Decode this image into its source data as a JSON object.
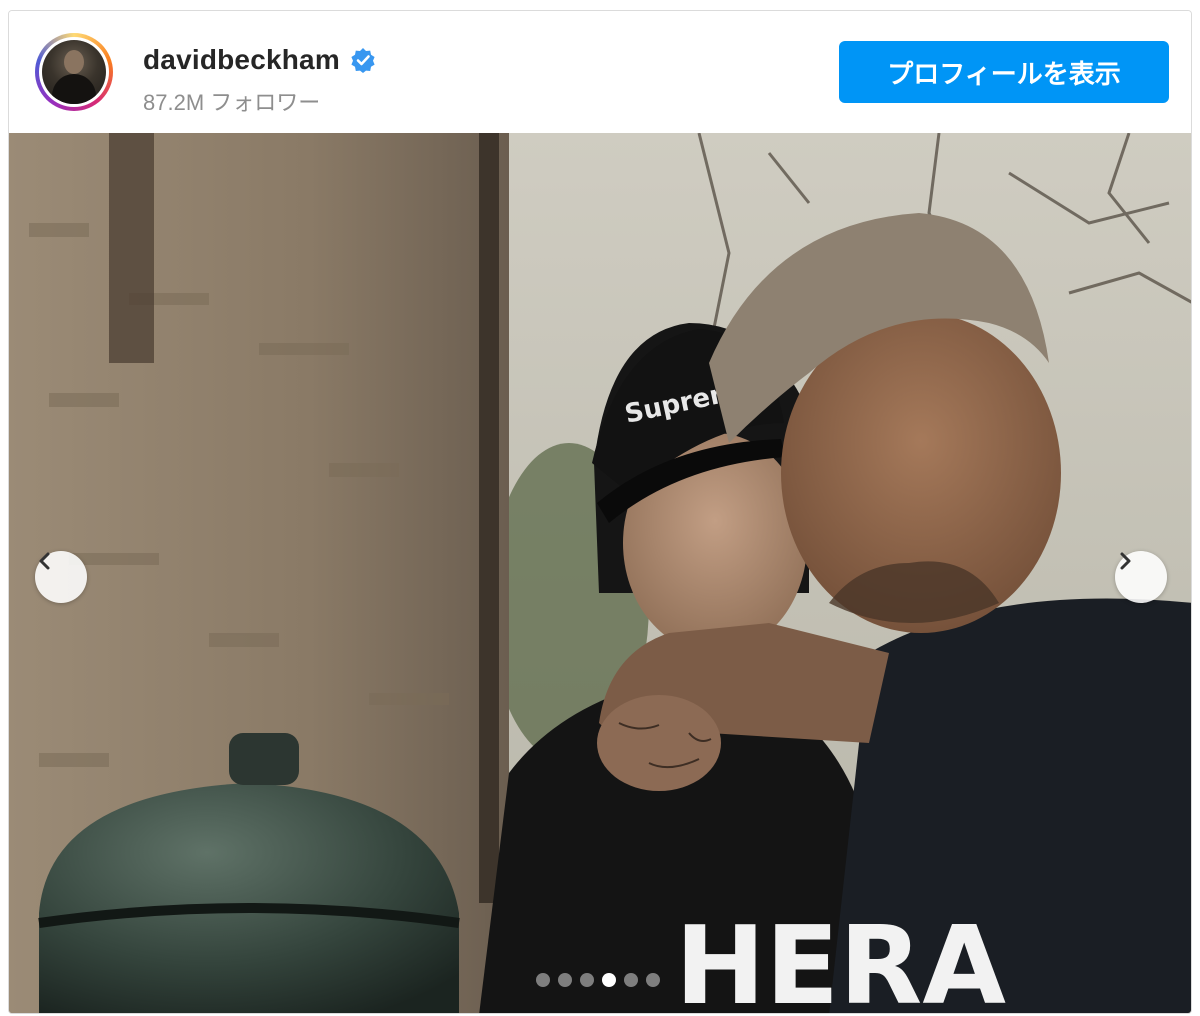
{
  "post": {
    "username": "davidbeckham",
    "followers": "87.2M フォロワー",
    "profile_button": "プロフィールを表示",
    "verified_icon": "verified-badge-icon",
    "accent_color": "#0095f6"
  },
  "carousel": {
    "slide_count": 6,
    "active_index": 3,
    "prev_icon": "chevron-left-icon",
    "next_icon": "chevron-right-icon"
  },
  "photo": {
    "cap_text": "Supreme",
    "shirt_text": "HERA"
  }
}
